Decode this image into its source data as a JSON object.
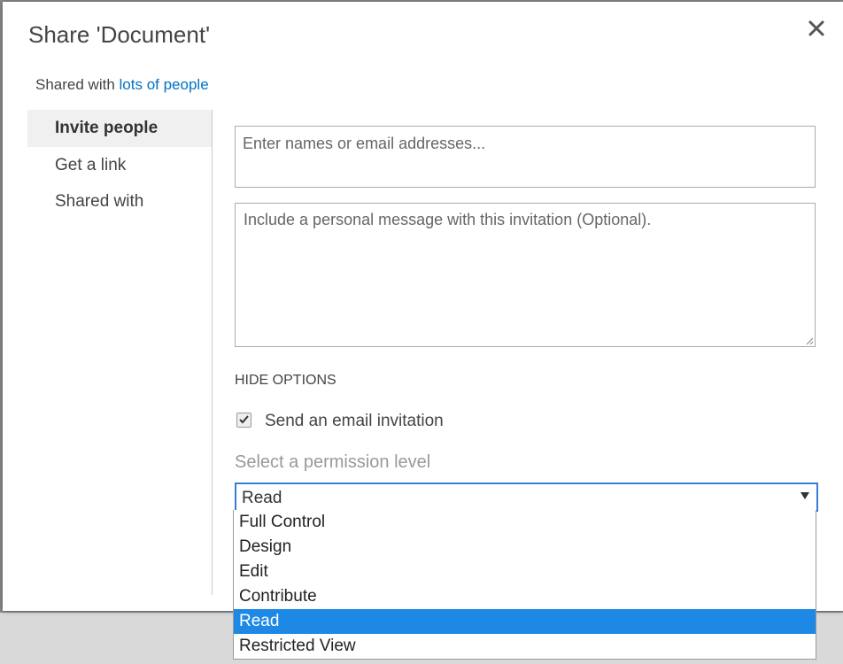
{
  "dialog": {
    "title": "Share 'Document'",
    "close_glyph": "✕",
    "shared_prefix": "Shared with",
    "shared_link": "lots of people"
  },
  "nav": {
    "items": [
      {
        "label": "Invite people"
      },
      {
        "label": "Get a link"
      },
      {
        "label": "Shared with"
      }
    ]
  },
  "form": {
    "names_placeholder": "Enter names or email addresses...",
    "message_placeholder": "Include a personal message with this invitation (Optional).",
    "hide_options": "HIDE OPTIONS",
    "send_email_label": "Send an email invitation",
    "send_email_checked": true,
    "permission_label": "Select a permission level",
    "permission_selected": "Read",
    "permission_options": [
      "Full Control",
      "Design",
      "Edit",
      "Contribute",
      "Read",
      "Restricted View"
    ]
  },
  "colors": {
    "link": "#0072c6",
    "select_border": "#3a7bd5",
    "highlight": "#1e88e5"
  }
}
